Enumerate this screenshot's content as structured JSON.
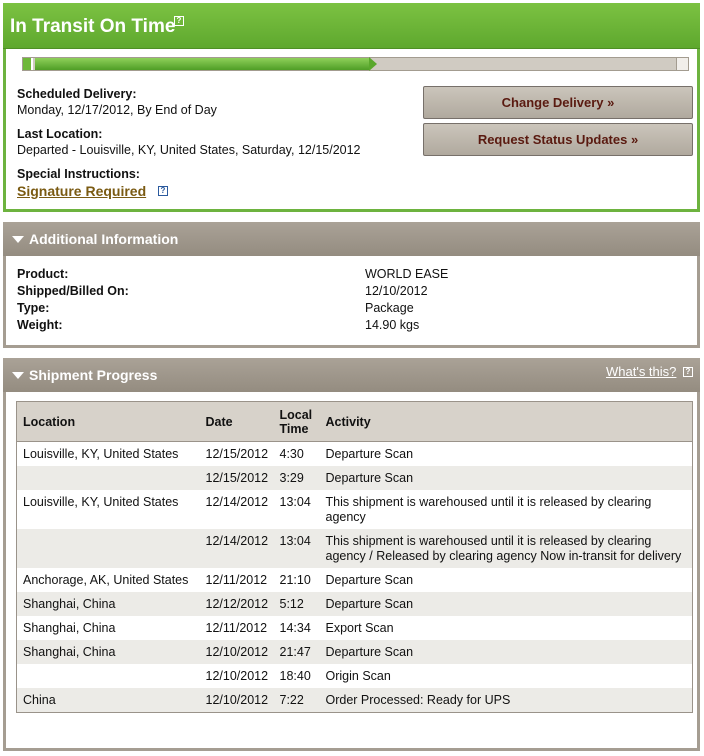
{
  "transit": {
    "title": "In Transit On Time",
    "help_glyph": "?",
    "progress": 0.52,
    "scheduled_label": "Scheduled Delivery:",
    "scheduled_value": "Monday, 12/17/2012, By End of Day",
    "last_location_label": "Last Location:",
    "last_location_value": "Departed - Louisville, KY, United States, Saturday, 12/15/2012",
    "special_label": "Special Instructions:",
    "signature_link": "Signature Required",
    "change_delivery_button": "Change Delivery »",
    "request_updates_button": "Request Status Updates »"
  },
  "additional": {
    "title": "Additional Information",
    "rows": [
      {
        "label": "Product:",
        "value": "WORLD EASE"
      },
      {
        "label": "Shipped/Billed On:",
        "value": "12/10/2012"
      },
      {
        "label": "Type:",
        "value": "Package"
      },
      {
        "label": "Weight:",
        "value": "14.90 kgs"
      }
    ]
  },
  "progress": {
    "title": "Shipment Progress",
    "whats_this": "What's this?",
    "columns": {
      "location": "Location",
      "date": "Date",
      "time_line1": "Local",
      "time_line2": "Time",
      "activity": "Activity"
    },
    "rows": [
      {
        "location": "Louisville, KY, United States",
        "date": "12/15/2012",
        "time": "4:30",
        "activity": "Departure Scan"
      },
      {
        "location": "",
        "date": "12/15/2012",
        "time": "3:29",
        "activity": "Departure Scan"
      },
      {
        "location": "Louisville, KY, United States",
        "date": "12/14/2012",
        "time": "13:04",
        "activity": "This shipment is warehoused until it is released by clearing agency"
      },
      {
        "location": "",
        "date": "12/14/2012",
        "time": "13:04",
        "activity": "This shipment is warehoused until it is released by clearing agency / Released by clearing agency Now in-transit for delivery"
      },
      {
        "location": "Anchorage, AK, United States",
        "date": "12/11/2012",
        "time": "21:10",
        "activity": "Departure Scan"
      },
      {
        "location": "Shanghai, China",
        "date": "12/12/2012",
        "time": "5:12",
        "activity": "Departure Scan"
      },
      {
        "location": "Shanghai, China",
        "date": "12/11/2012",
        "time": "14:34",
        "activity": "Export Scan"
      },
      {
        "location": "Shanghai, China",
        "date": "12/10/2012",
        "time": "21:47",
        "activity": "Departure Scan"
      },
      {
        "location": "",
        "date": "12/10/2012",
        "time": "18:40",
        "activity": "Origin Scan"
      },
      {
        "location": "China",
        "date": "12/10/2012",
        "time": "7:22",
        "activity": "Order Processed: Ready for UPS"
      }
    ]
  }
}
